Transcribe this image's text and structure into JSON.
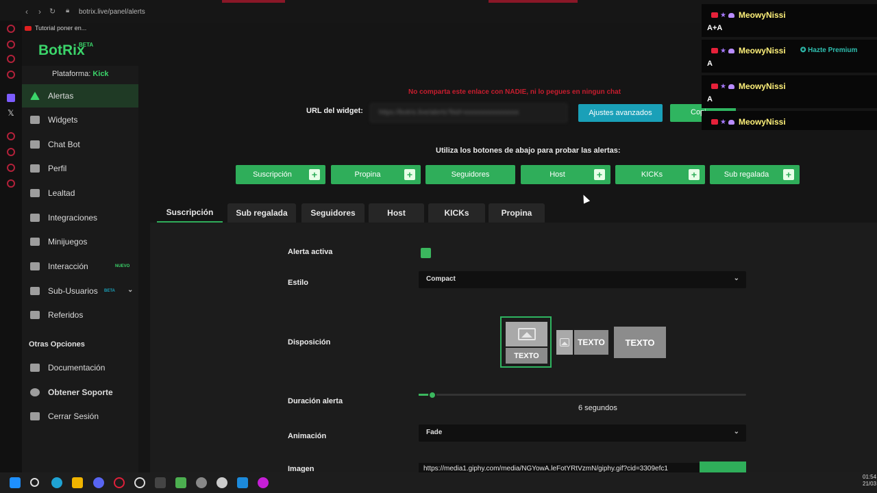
{
  "browser": {
    "url": "botrix.live/panel/alerts",
    "bookmark": "Tutorial poner en..."
  },
  "logo": {
    "name": "BotRix",
    "badge": "BETA"
  },
  "platform": {
    "label": "Plataforma:",
    "value": "Kick"
  },
  "sidebar": {
    "items": [
      {
        "label": "Alertas",
        "active": true
      },
      {
        "label": "Widgets"
      },
      {
        "label": "Chat Bot"
      },
      {
        "label": "Perfil"
      },
      {
        "label": "Lealtad"
      },
      {
        "label": "Integraciones"
      },
      {
        "label": "Minijuegos"
      },
      {
        "label": "Interacción",
        "badge": "NUEVO"
      },
      {
        "label": "Sub-Usuarios",
        "badge": "BETA"
      },
      {
        "label": "Referidos"
      }
    ],
    "other_heading": "Otras Opciones",
    "other_items": [
      {
        "label": "Documentación"
      },
      {
        "label": "Obtener Soporte"
      },
      {
        "label": "Cerrar Sesión"
      }
    ]
  },
  "widget": {
    "warning": "No comparta este enlace con NADIE, ni lo pegues en ningun chat",
    "url_label": "URL del widget:",
    "url_value": "https://botrix.live/alerts?bid=xxxxxxxxxxxxxxxx",
    "advanced_button": "Ajustes avanzados",
    "copy_button": "Copi"
  },
  "test": {
    "instruction": "Utiliza los botones de abajo para probar las alertas:",
    "buttons": [
      {
        "label": "Suscripción",
        "plus": true
      },
      {
        "label": "Propina",
        "plus": true
      },
      {
        "label": "Seguidores",
        "plus": false
      },
      {
        "label": "Host",
        "plus": true
      },
      {
        "label": "KICKs",
        "plus": true
      },
      {
        "label": "Sub regalada",
        "plus": true
      }
    ],
    "plus_symbol": "+"
  },
  "tabs": [
    {
      "label": "Suscripción",
      "active": true
    },
    {
      "label": "Sub regalada"
    },
    {
      "label": "Seguidores"
    },
    {
      "label": "Host"
    },
    {
      "label": "KICKs"
    },
    {
      "label": "Propina"
    }
  ],
  "settings": {
    "active_label": "Alerta activa",
    "active_value": true,
    "style_label": "Estilo",
    "style_value": "Compact",
    "layout_label": "Disposición",
    "layout_text": "TEXTO",
    "duration_label": "Duración alerta",
    "duration_value": 6,
    "duration_text": "6 segundos",
    "animation_label": "Animación",
    "animation_value": "Fade",
    "image_label": "Imagen",
    "image_value": "https://media1.giphy.com/media/NGYowA.leFotYRtVzmN/giphy.gif?cid=3309efc1"
  },
  "chat": {
    "messages": [
      {
        "user": "MeowyNissi",
        "text": "A+A"
      },
      {
        "user": "MeowyNissi",
        "text": "A"
      },
      {
        "user": "MeowyNissi",
        "text": "A"
      },
      {
        "user": "MeowyNissi",
        "text": ""
      }
    ],
    "premium": "Hazte Premium"
  },
  "taskbar": {
    "time": "01:54",
    "date": "21/03"
  },
  "colors": {
    "accent": "#2fae5a",
    "info": "#1aa0b8",
    "warning": "#c81d2e",
    "chat_name": "#fff17a"
  }
}
